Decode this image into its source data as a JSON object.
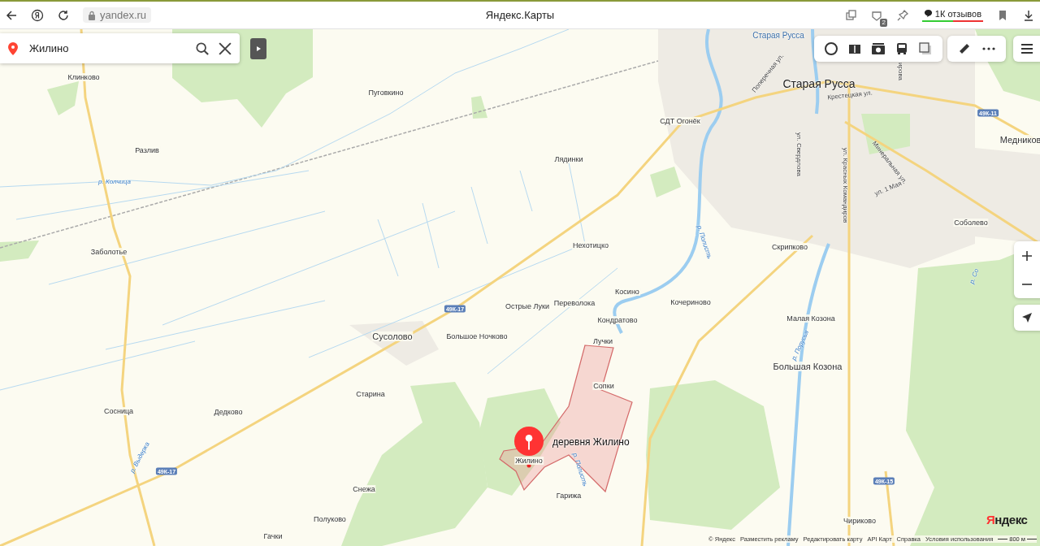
{
  "browser": {
    "address": "yandex.ru",
    "title": "Яндекс.Карты",
    "counter": "2",
    "reviews": "1К отзывов"
  },
  "search": {
    "value": "Жилино"
  },
  "map": {
    "labels": [
      {
        "text": "Старая Русса",
        "kind": "district"
      },
      {
        "text": "Клинково",
        "kind": "place"
      },
      {
        "text": "Пуговкино",
        "kind": "place"
      },
      {
        "text": "Разлив",
        "kind": "place"
      },
      {
        "text": "р. Колчица",
        "kind": "river"
      },
      {
        "text": "Заболотье",
        "kind": "place"
      },
      {
        "text": "Поперечная ул.",
        "kind": "street"
      },
      {
        "text": "ирова",
        "kind": "street"
      },
      {
        "text": "Старая Русса",
        "kind": "city"
      },
      {
        "text": "Крестецкая ул.",
        "kind": "street"
      },
      {
        "text": "49К-11",
        "kind": "route"
      },
      {
        "text": "СДТ Огонёк",
        "kind": "place"
      },
      {
        "text": "Медников",
        "kind": "town"
      },
      {
        "text": "Лядинки",
        "kind": "place"
      },
      {
        "text": "ул. Свердлова",
        "kind": "street"
      },
      {
        "text": "ул. Красных Командиров",
        "kind": "street"
      },
      {
        "text": "Минеральная ул.",
        "kind": "street"
      },
      {
        "text": "ул. 1 Мая",
        "kind": "street"
      },
      {
        "text": "Соболево",
        "kind": "place"
      },
      {
        "text": "р. Полисть",
        "kind": "river"
      },
      {
        "text": "Нехотицко",
        "kind": "place"
      },
      {
        "text": "Скрипково",
        "kind": "place"
      },
      {
        "text": "р. Со",
        "kind": "river"
      },
      {
        "text": "Косино",
        "kind": "place"
      },
      {
        "text": "Переволока",
        "kind": "place"
      },
      {
        "text": "Острые Луки",
        "kind": "place"
      },
      {
        "text": "Кочериново",
        "kind": "place"
      },
      {
        "text": "49К-17",
        "kind": "route"
      },
      {
        "text": "Кондратово",
        "kind": "place"
      },
      {
        "text": "Малая Козона",
        "kind": "place"
      },
      {
        "text": "р. Порусья",
        "kind": "river"
      },
      {
        "text": "Сусолово",
        "kind": "town"
      },
      {
        "text": "Большое Ночково",
        "kind": "place"
      },
      {
        "text": "Лучки",
        "kind": "place"
      },
      {
        "text": "Большая Козона",
        "kind": "town"
      },
      {
        "text": "Сопки",
        "kind": "place"
      },
      {
        "text": "Старина",
        "kind": "place"
      },
      {
        "text": "Сосница",
        "kind": "place"
      },
      {
        "text": "Дедково",
        "kind": "place"
      },
      {
        "text": "Жилино",
        "kind": "place"
      },
      {
        "text": "р. Полисть",
        "kind": "river"
      },
      {
        "text": "р. Выдерка",
        "kind": "river"
      },
      {
        "text": "49К-17",
        "kind": "route"
      },
      {
        "text": "49К-15",
        "kind": "route"
      },
      {
        "text": "Снежа",
        "kind": "place"
      },
      {
        "text": "Гарижа",
        "kind": "place"
      },
      {
        "text": "Полуково",
        "kind": "place"
      },
      {
        "text": "Чириково",
        "kind": "place"
      },
      {
        "text": "Гачки",
        "kind": "place"
      }
    ],
    "marker_label": "деревня Жилино"
  },
  "footer": {
    "logo": "Яндекс",
    "copyright": "© Яндекс",
    "links": [
      "Разместить рекламу",
      "Редактировать карту",
      "API Карт",
      "Справка",
      "Условия использования"
    ],
    "scale": "800 м"
  }
}
